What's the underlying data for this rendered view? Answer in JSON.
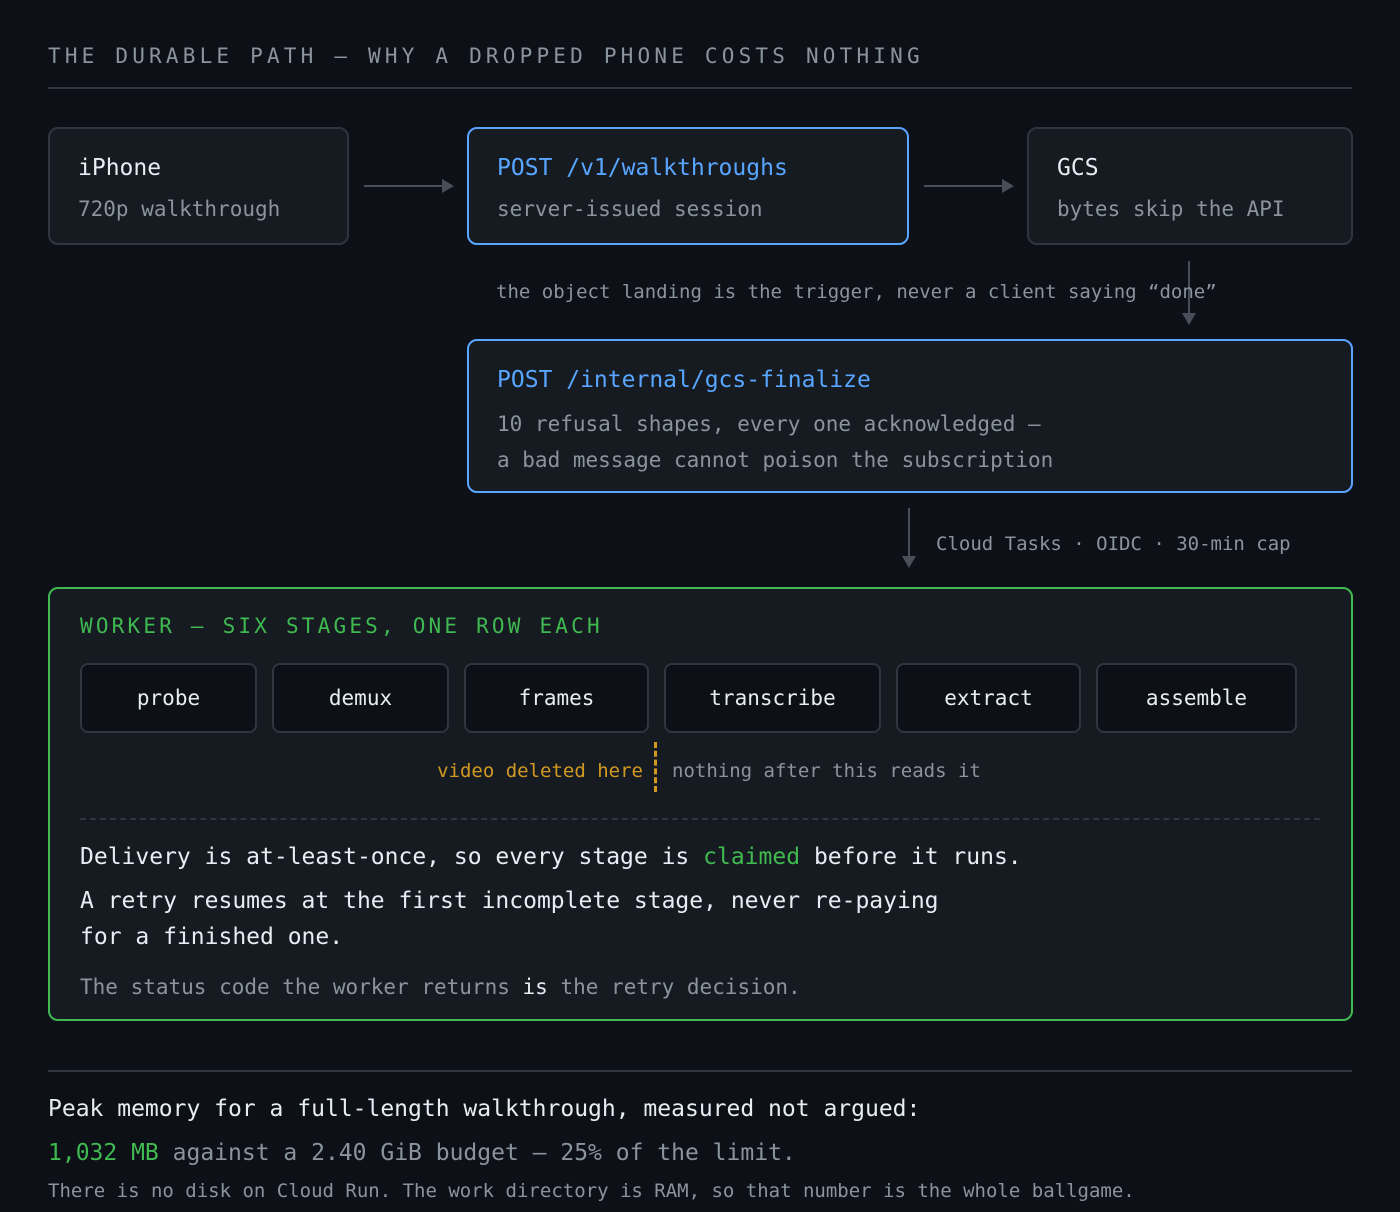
{
  "header": {
    "title": "THE DURABLE PATH — WHY A DROPPED PHONE COSTS NOTHING"
  },
  "flow": {
    "iphone": {
      "title": "iPhone",
      "subtitle": "720p walkthrough"
    },
    "post_walkthroughs": {
      "title": "POST /v1/walkthroughs",
      "subtitle": "server-issued session"
    },
    "gcs": {
      "title": "GCS",
      "subtitle": "bytes skip the API"
    },
    "trigger_note": "the object landing is the trigger, never a client saying “done”",
    "gcs_finalize": {
      "title": "POST /internal/gcs-finalize",
      "line1": "10 refusal shapes, every one acknowledged —",
      "line2": "a bad message cannot poison the subscription"
    },
    "tasks_note": "Cloud Tasks · OIDC · 30-min cap"
  },
  "worker": {
    "title": "WORKER — SIX STAGES, ONE ROW EACH",
    "stages": [
      "probe",
      "demux",
      "frames",
      "transcribe",
      "extract",
      "assemble"
    ],
    "deleted_label": "video deleted here",
    "after_label": "nothing after this reads it",
    "delivery": {
      "before": "Delivery is at-least-once, so every stage is",
      "highlight": "claimed",
      "after": "before it runs."
    },
    "retry_line1": "A retry resumes at the first incomplete stage, never re-paying",
    "retry_line2": "for a finished one.",
    "status": {
      "before": "The status code the worker returns",
      "emphasis": "is",
      "after": "the retry decision."
    }
  },
  "footer": {
    "line1": "Peak memory for a full-length walkthrough, measured not argued:",
    "memory_value": "1,032 MB",
    "line2_rest": "against a 2.40 GiB budget — 25% of the limit.",
    "line3": "There is no disk on Cloud Run. The work directory is RAM, so that number is the whole ballgame."
  },
  "colors": {
    "background": "#0d1117",
    "accent_blue": "#58a6ff",
    "accent_green": "#3fb950",
    "accent_amber": "#d29922"
  }
}
